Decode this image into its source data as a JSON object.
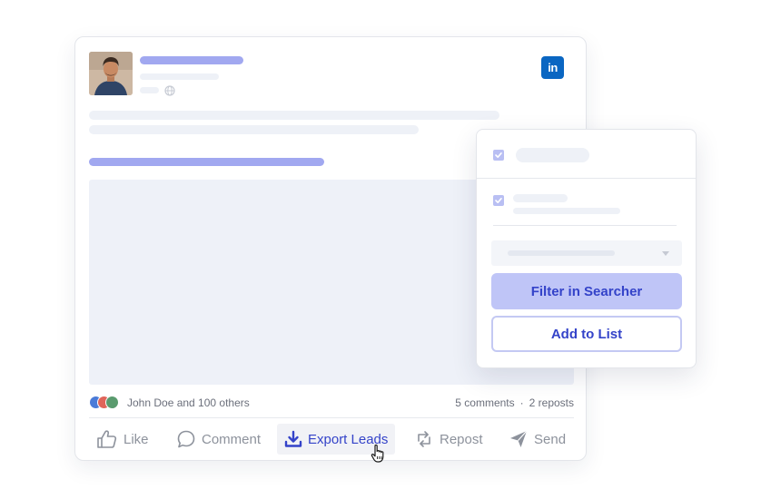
{
  "post": {
    "brand_icon": "linkedin-icon",
    "brand_icon_text": "in",
    "reactions_text": "John Doe and 100 others",
    "comments_text": "5 comments",
    "separator": "·",
    "reposts_text": "2 reposts"
  },
  "actions": {
    "like_label": "Like",
    "comment_label": "Comment",
    "export_label": "Export Leads",
    "repost_label": "Repost",
    "send_label": "Send"
  },
  "panel": {
    "filter_button_label": "Filter in Searcher",
    "add_button_label": "Add to List"
  },
  "colors": {
    "accent": "#3443c9",
    "placeholder_accent": "#a1a8f0",
    "linkedin": "#0a66c2",
    "filter_button_bg": "#bfc5f7"
  }
}
